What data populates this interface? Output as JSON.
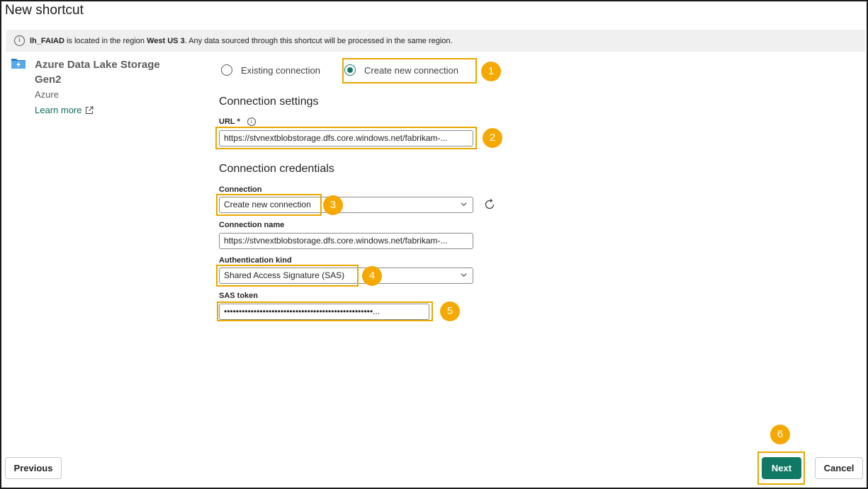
{
  "dialog": {
    "title": "New shortcut"
  },
  "banner": {
    "lakehouse": "lh_FAIAD",
    "text_1": " is located in the region ",
    "region": "West US 3",
    "text_2": ". Any data sourced through this shortcut will be processed in the same region."
  },
  "source": {
    "name": "Azure Data Lake Storage Gen2",
    "type": "Azure",
    "learn_more": "Learn more",
    "icon": "adls-gen2-icon"
  },
  "connection_mode": {
    "existing_label": "Existing connection",
    "new_label": "Create new connection",
    "selected": "new"
  },
  "connection_settings": {
    "heading": "Connection settings",
    "url_label": "URL *",
    "url_value": "https://stvnextblobstorage.dfs.core.windows.net/fabrikam-..."
  },
  "connection_credentials": {
    "heading": "Connection credentials",
    "connection_label": "Connection",
    "connection_value": "Create new connection",
    "connection_name_label": "Connection name",
    "connection_name_value": "https://stvnextblobstorage.dfs.core.windows.net/fabrikam-...",
    "auth_label": "Authentication kind",
    "auth_value": "Shared Access Signature (SAS)",
    "sas_label": "SAS token",
    "sas_value": "••••••••••••••••••••••••••••••••••••••••••••••••••..."
  },
  "callouts": [
    "1",
    "2",
    "3",
    "4",
    "5",
    "6"
  ],
  "footer": {
    "previous": "Previous",
    "next": "Next",
    "cancel": "Cancel"
  },
  "colors": {
    "accent": "#117865",
    "highlight": "#e8a800",
    "badge": "#f5a800"
  }
}
